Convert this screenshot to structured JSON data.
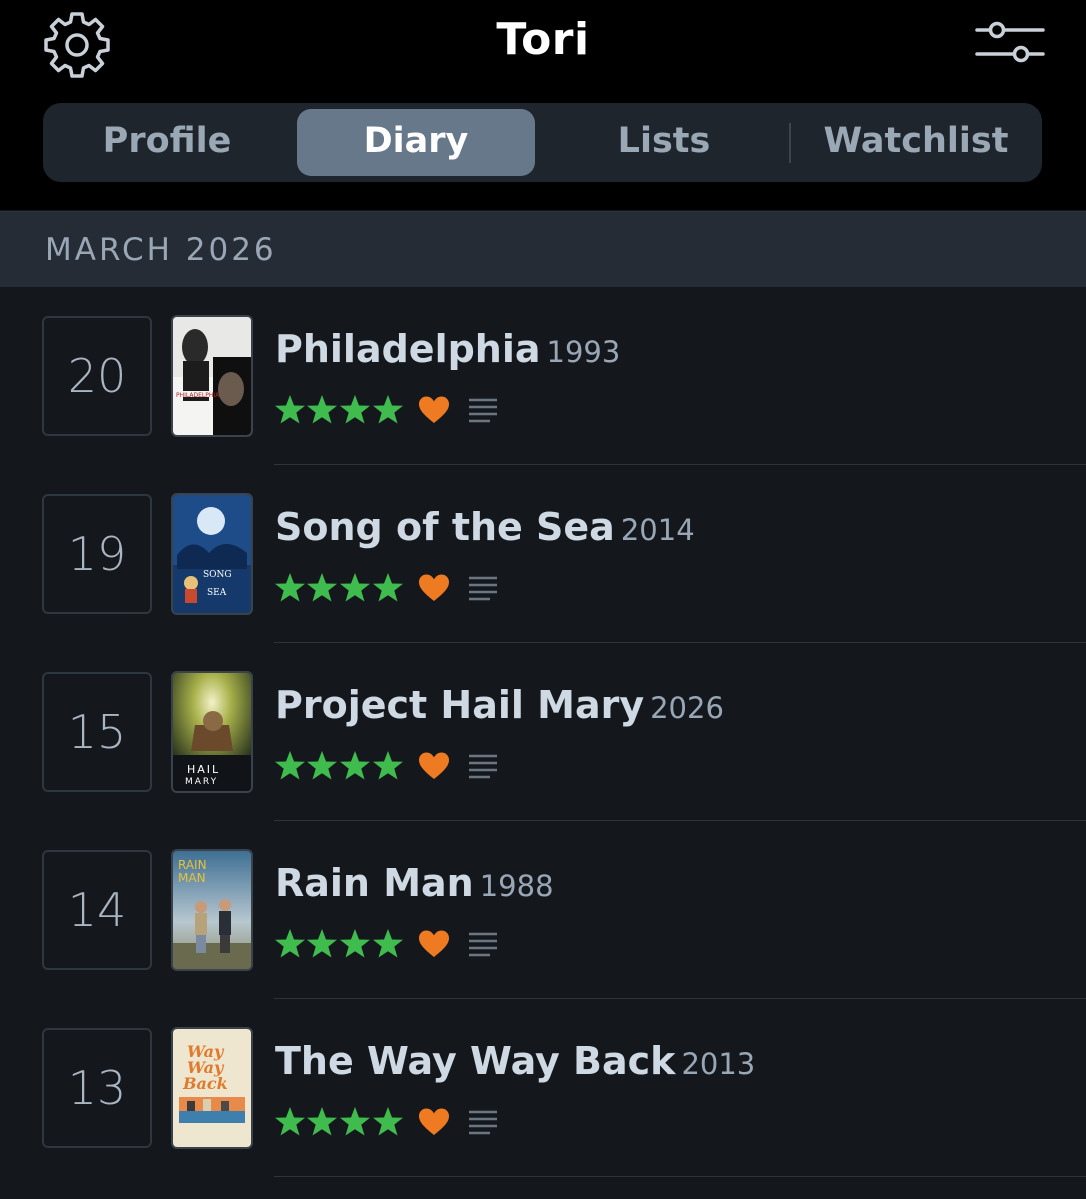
{
  "header": {
    "title": "Tori",
    "settings_icon": "gear-icon",
    "filter_icon": "sliders-icon"
  },
  "tabs": [
    {
      "label": "Profile",
      "active": false
    },
    {
      "label": "Diary",
      "active": true
    },
    {
      "label": "Lists",
      "active": false
    },
    {
      "label": "Watchlist",
      "active": false
    }
  ],
  "month": "MARCH 2026",
  "colors": {
    "star": "#40bc4f",
    "heart": "#ee7b22",
    "review_icon": "#6b7683",
    "active_tab": "#68788b"
  },
  "entries": [
    {
      "day": "20",
      "title": "Philadelphia",
      "year": "1993",
      "rating": 4,
      "liked": true,
      "has_review": true,
      "poster_text": "PHILADELPHIA"
    },
    {
      "day": "19",
      "title": "Song of the Sea",
      "year": "2014",
      "rating": 4,
      "liked": true,
      "has_review": true,
      "poster_text": "SONG of the SEA"
    },
    {
      "day": "15",
      "title": "Project Hail Mary",
      "year": "2026",
      "rating": 4,
      "liked": true,
      "has_review": true,
      "poster_text": "HAIL MARY"
    },
    {
      "day": "14",
      "title": "Rain Man",
      "year": "1988",
      "rating": 4,
      "liked": true,
      "has_review": true,
      "poster_text": "RAIN MAN"
    },
    {
      "day": "13",
      "title": "The Way Way Back",
      "year": "2013",
      "rating": 4,
      "liked": true,
      "has_review": true,
      "poster_text": "The Way Way Back"
    }
  ]
}
